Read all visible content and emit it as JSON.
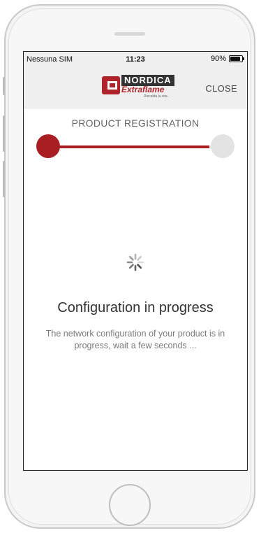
{
  "status_bar": {
    "carrier": "Nessuna SIM",
    "time": "11:23",
    "battery": "90%",
    "battery_level": 0.9
  },
  "header": {
    "brand_name": "NORDICA",
    "brand_sub": "Extraflame",
    "tagline": "Riscalda la vita.",
    "close_label": "CLOSE"
  },
  "registration": {
    "title": "PRODUCT REGISTRATION",
    "progress": 0.92
  },
  "status": {
    "title": "Configuration in progress",
    "message": "The network configuration of your product is in progress, wait a few seconds ..."
  },
  "colors": {
    "accent": "#a81e22",
    "track": "#e3e3e3"
  },
  "icons": {
    "spinner": "activity-spinner-icon",
    "battery": "battery-icon",
    "logo": "nordica-extraflame-logo"
  }
}
